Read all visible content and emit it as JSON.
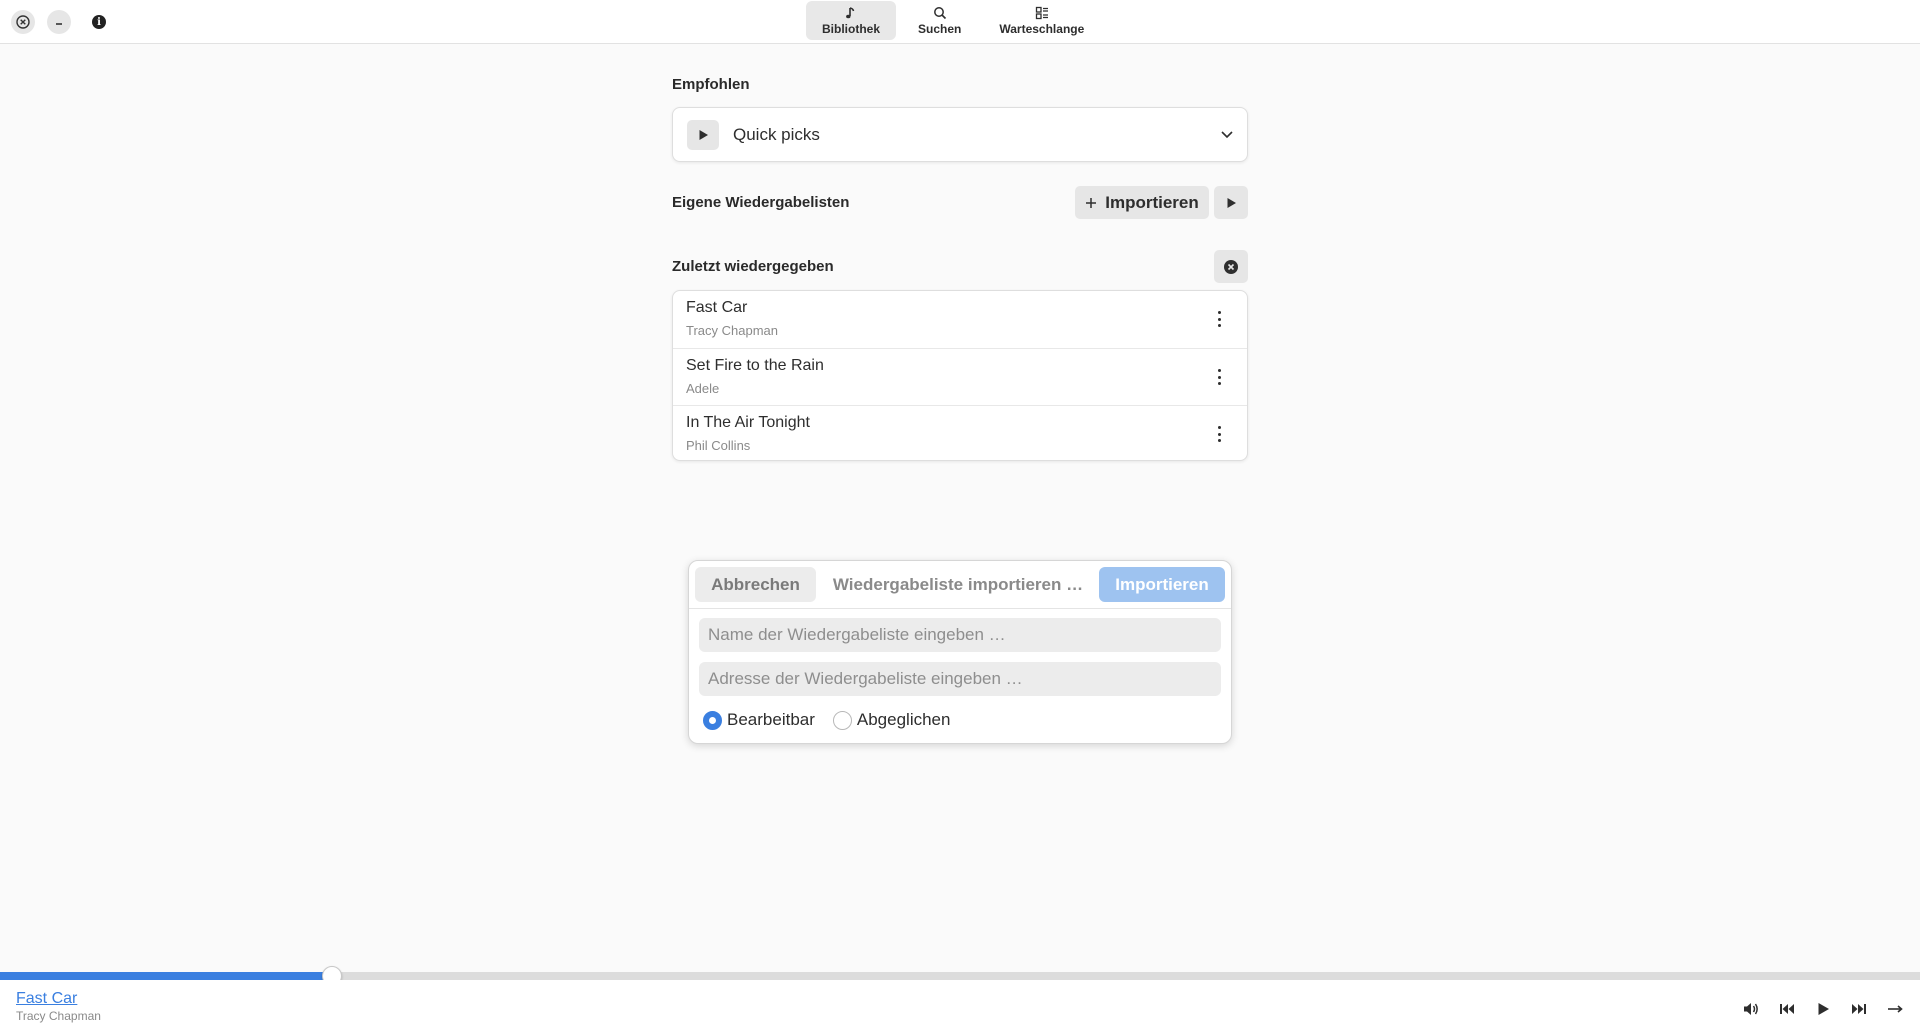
{
  "header": {
    "tabs": [
      {
        "label": "Bibliothek",
        "icon": "music-note-icon",
        "active": true
      },
      {
        "label": "Suchen",
        "icon": "search-icon",
        "active": false
      },
      {
        "label": "Warteschlange",
        "icon": "queue-icon",
        "active": false
      }
    ]
  },
  "recommended": {
    "title": "Empfohlen",
    "selected": "Quick picks"
  },
  "own_playlists": {
    "title": "Eigene Wiedergabelisten",
    "import_label": "Importieren"
  },
  "recent": {
    "title": "Zuletzt wiedergegeben",
    "items": [
      {
        "title": "Fast Car",
        "artist": "Tracy Chapman"
      },
      {
        "title": "Set Fire to the Rain",
        "artist": "Adele"
      },
      {
        "title": "In The Air Tonight",
        "artist": "Phil Collins"
      }
    ]
  },
  "dialog": {
    "cancel_label": "Abbrechen",
    "title": "Wiedergabeliste importieren …",
    "import_label": "Importieren",
    "name_placeholder": "Name der Wiedergabeliste eingeben …",
    "url_placeholder": "Adresse der Wiedergabeliste eingeben …",
    "options": [
      {
        "label": "Bearbeitbar",
        "selected": true
      },
      {
        "label": "Abgeglichen",
        "selected": false
      }
    ]
  },
  "player": {
    "title": "Fast Car",
    "artist": "Tracy Chapman",
    "progress": 0.173
  },
  "colors": {
    "accent": "#3a7fe0",
    "import_disabled": "#9ec3f0"
  }
}
